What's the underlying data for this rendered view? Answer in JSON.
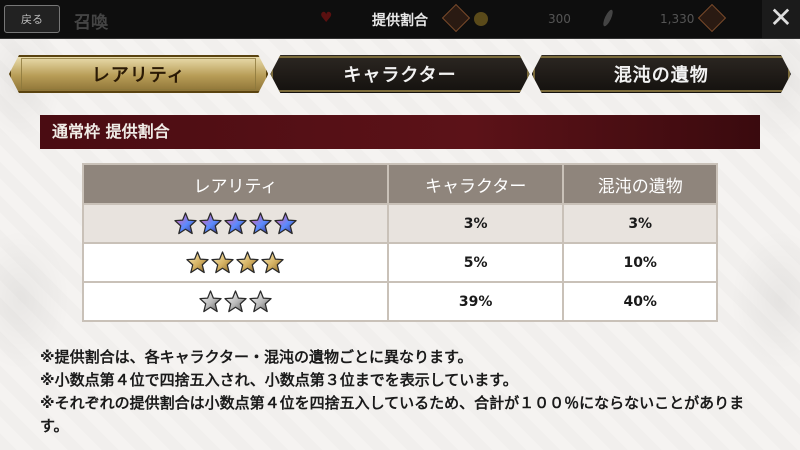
{
  "topbar": {
    "back_label": "戻る",
    "screen_title": "召喚",
    "dialog_title": "提供割合",
    "resource_1": "300",
    "resource_2": "1,330",
    "close_glyph": "✕"
  },
  "tabs": [
    {
      "label": "レアリティ",
      "active": true
    },
    {
      "label": "キャラクター",
      "active": false
    },
    {
      "label": "混沌の遺物",
      "active": false
    }
  ],
  "section": {
    "title": "通常枠  提供割合"
  },
  "table": {
    "headers": [
      "レアリティ",
      "キャラクター",
      "混沌の遺物"
    ],
    "rows": [
      {
        "stars": 5,
        "star_color": "rainbow",
        "character": "3%",
        "relic": "3%"
      },
      {
        "stars": 4,
        "star_color": "gold",
        "character": "5%",
        "relic": "10%"
      },
      {
        "stars": 3,
        "star_color": "silver",
        "character": "39%",
        "relic": "40%"
      }
    ]
  },
  "notes": [
    "※提供割合は、各キャラクター・混沌の遺物ごとに異なります。",
    "※小数点第４位で四捨五入され、小数点第３位までを表示しています。",
    "※それぞれの提供割合は小数点第４位を四捨五入しているため、合計が１００％にならないことがあります。"
  ],
  "colors": {
    "section_header": "#4a0c12",
    "table_header": "#8f857c",
    "tab_active": "#b79c56",
    "tab_inactive": "#14110e"
  }
}
